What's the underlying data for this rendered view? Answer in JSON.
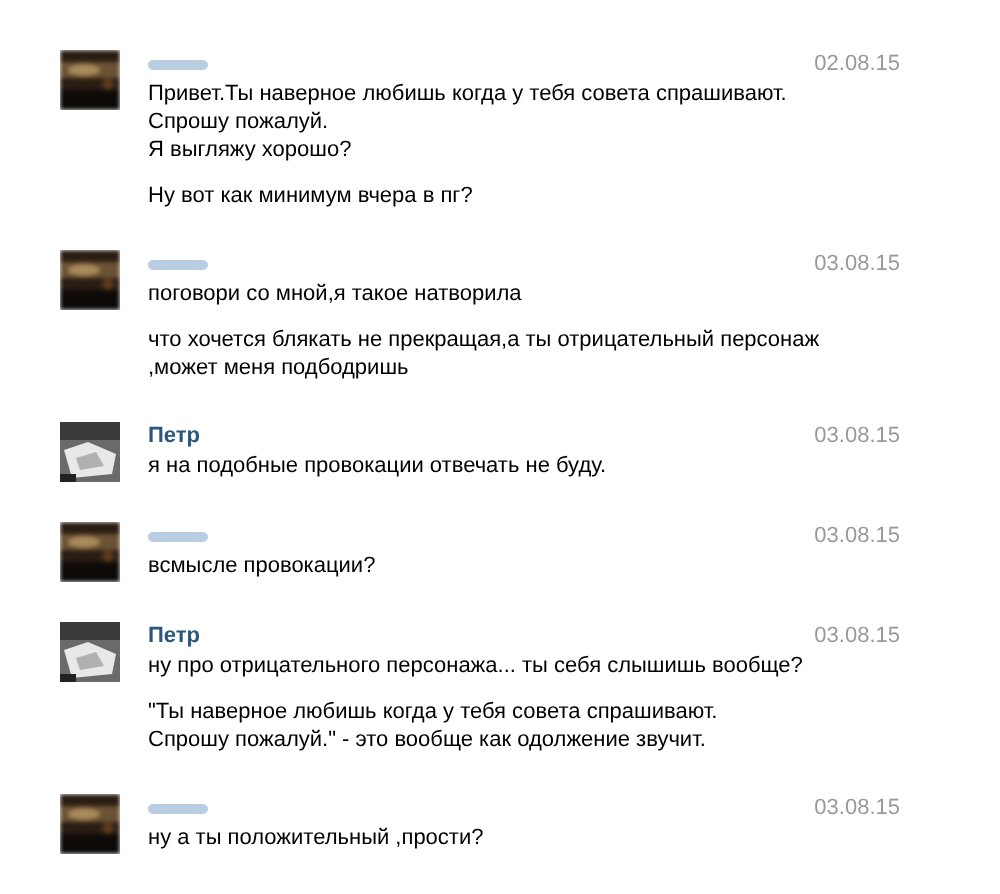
{
  "messages": [
    {
      "author": {
        "kind": "redacted"
      },
      "avatar": {
        "kind": "picture"
      },
      "date": "02.08.15",
      "paragraphs": [
        [
          "Привет.Ты наверное любишь когда у тебя совета спрашивают.",
          "Спрошу пожалуй.",
          "Я выгляжу хорошо?"
        ],
        [
          "Ну вот как минимум вчера в пг?"
        ]
      ]
    },
    {
      "author": {
        "kind": "redacted"
      },
      "avatar": {
        "kind": "picture"
      },
      "date": "03.08.15",
      "paragraphs": [
        [
          "поговори со мной,я такое натворила"
        ],
        [
          "что хочется блякать не прекращая,а ты отрицательный персонаж",
          ",может меня подбодришь"
        ]
      ]
    },
    {
      "author": {
        "kind": "name",
        "name": "Петр"
      },
      "avatar": {
        "kind": "picture"
      },
      "date": "03.08.15",
      "paragraphs": [
        [
          "я на подобные провокации отвечать не буду."
        ]
      ]
    },
    {
      "author": {
        "kind": "redacted"
      },
      "avatar": {
        "kind": "picture"
      },
      "date": "03.08.15",
      "paragraphs": [
        [
          "всмысле провокации?"
        ]
      ]
    },
    {
      "author": {
        "kind": "name",
        "name": "Петр"
      },
      "avatar": {
        "kind": "picture"
      },
      "date": "03.08.15",
      "paragraphs": [
        [
          "ну про отрицательного персонажа... ты себя слышишь вообще?"
        ],
        [
          "\"Ты наверное любишь когда у тебя совета спрашивают.",
          "Спрошу пожалуй.\" - это вообще как одолжение звучит."
        ]
      ]
    },
    {
      "author": {
        "kind": "redacted"
      },
      "avatar": {
        "kind": "picture"
      },
      "date": "03.08.15",
      "paragraphs": [
        [
          "ну а ты положительный ,прости?"
        ]
      ]
    }
  ]
}
